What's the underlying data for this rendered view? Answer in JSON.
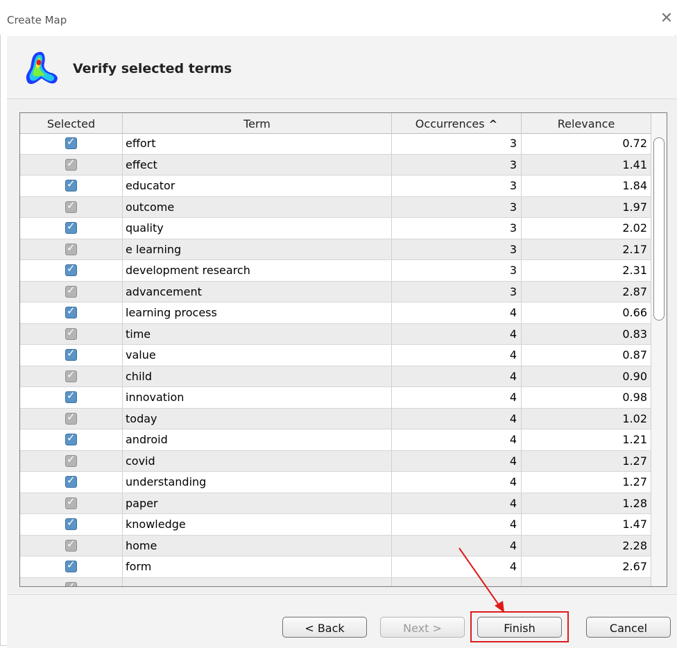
{
  "window": {
    "title": "Create Map"
  },
  "header": {
    "title": "Verify selected terms"
  },
  "table": {
    "columns": {
      "selected": "Selected",
      "term": "Term",
      "occurrences": "Occurrences",
      "relevance": "Relevance"
    },
    "sort": {
      "column": "occurrences",
      "direction": "ascending",
      "indicator": "^"
    },
    "rows": [
      {
        "selected": true,
        "term": "effort",
        "occurrences": "3",
        "relevance": "0.72"
      },
      {
        "selected": true,
        "term": "effect",
        "occurrences": "3",
        "relevance": "1.41"
      },
      {
        "selected": true,
        "term": "educator",
        "occurrences": "3",
        "relevance": "1.84"
      },
      {
        "selected": true,
        "term": "outcome",
        "occurrences": "3",
        "relevance": "1.97"
      },
      {
        "selected": true,
        "term": "quality",
        "occurrences": "3",
        "relevance": "2.02"
      },
      {
        "selected": true,
        "term": "e learning",
        "occurrences": "3",
        "relevance": "2.17"
      },
      {
        "selected": true,
        "term": "development research",
        "occurrences": "3",
        "relevance": "2.31"
      },
      {
        "selected": true,
        "term": "advancement",
        "occurrences": "3",
        "relevance": "2.87"
      },
      {
        "selected": true,
        "term": "learning process",
        "occurrences": "4",
        "relevance": "0.66"
      },
      {
        "selected": true,
        "term": "time",
        "occurrences": "4",
        "relevance": "0.83"
      },
      {
        "selected": true,
        "term": "value",
        "occurrences": "4",
        "relevance": "0.87"
      },
      {
        "selected": true,
        "term": "child",
        "occurrences": "4",
        "relevance": "0.90"
      },
      {
        "selected": true,
        "term": "innovation",
        "occurrences": "4",
        "relevance": "0.98"
      },
      {
        "selected": true,
        "term": "today",
        "occurrences": "4",
        "relevance": "1.02"
      },
      {
        "selected": true,
        "term": "android",
        "occurrences": "4",
        "relevance": "1.21"
      },
      {
        "selected": true,
        "term": "covid",
        "occurrences": "4",
        "relevance": "1.27"
      },
      {
        "selected": true,
        "term": "understanding",
        "occurrences": "4",
        "relevance": "1.27"
      },
      {
        "selected": true,
        "term": "paper",
        "occurrences": "4",
        "relevance": "1.28"
      },
      {
        "selected": true,
        "term": "knowledge",
        "occurrences": "4",
        "relevance": "1.47"
      },
      {
        "selected": true,
        "term": "home",
        "occurrences": "4",
        "relevance": "2.28"
      },
      {
        "selected": true,
        "term": "form",
        "occurrences": "4",
        "relevance": "2.67"
      }
    ]
  },
  "buttons": {
    "back": "< Back",
    "next": "Next >",
    "finish": "Finish",
    "cancel": "Cancel"
  },
  "icons": {
    "close": "close-icon",
    "logo": "heatmap-logo-icon",
    "sort": "sort-ascending-icon",
    "check": "checkbox-checked-icon"
  },
  "colors": {
    "checkbox_checked": "#5b94c6",
    "checkbox_dim": "#b4b4b4",
    "annotation": "#e01a1a"
  }
}
